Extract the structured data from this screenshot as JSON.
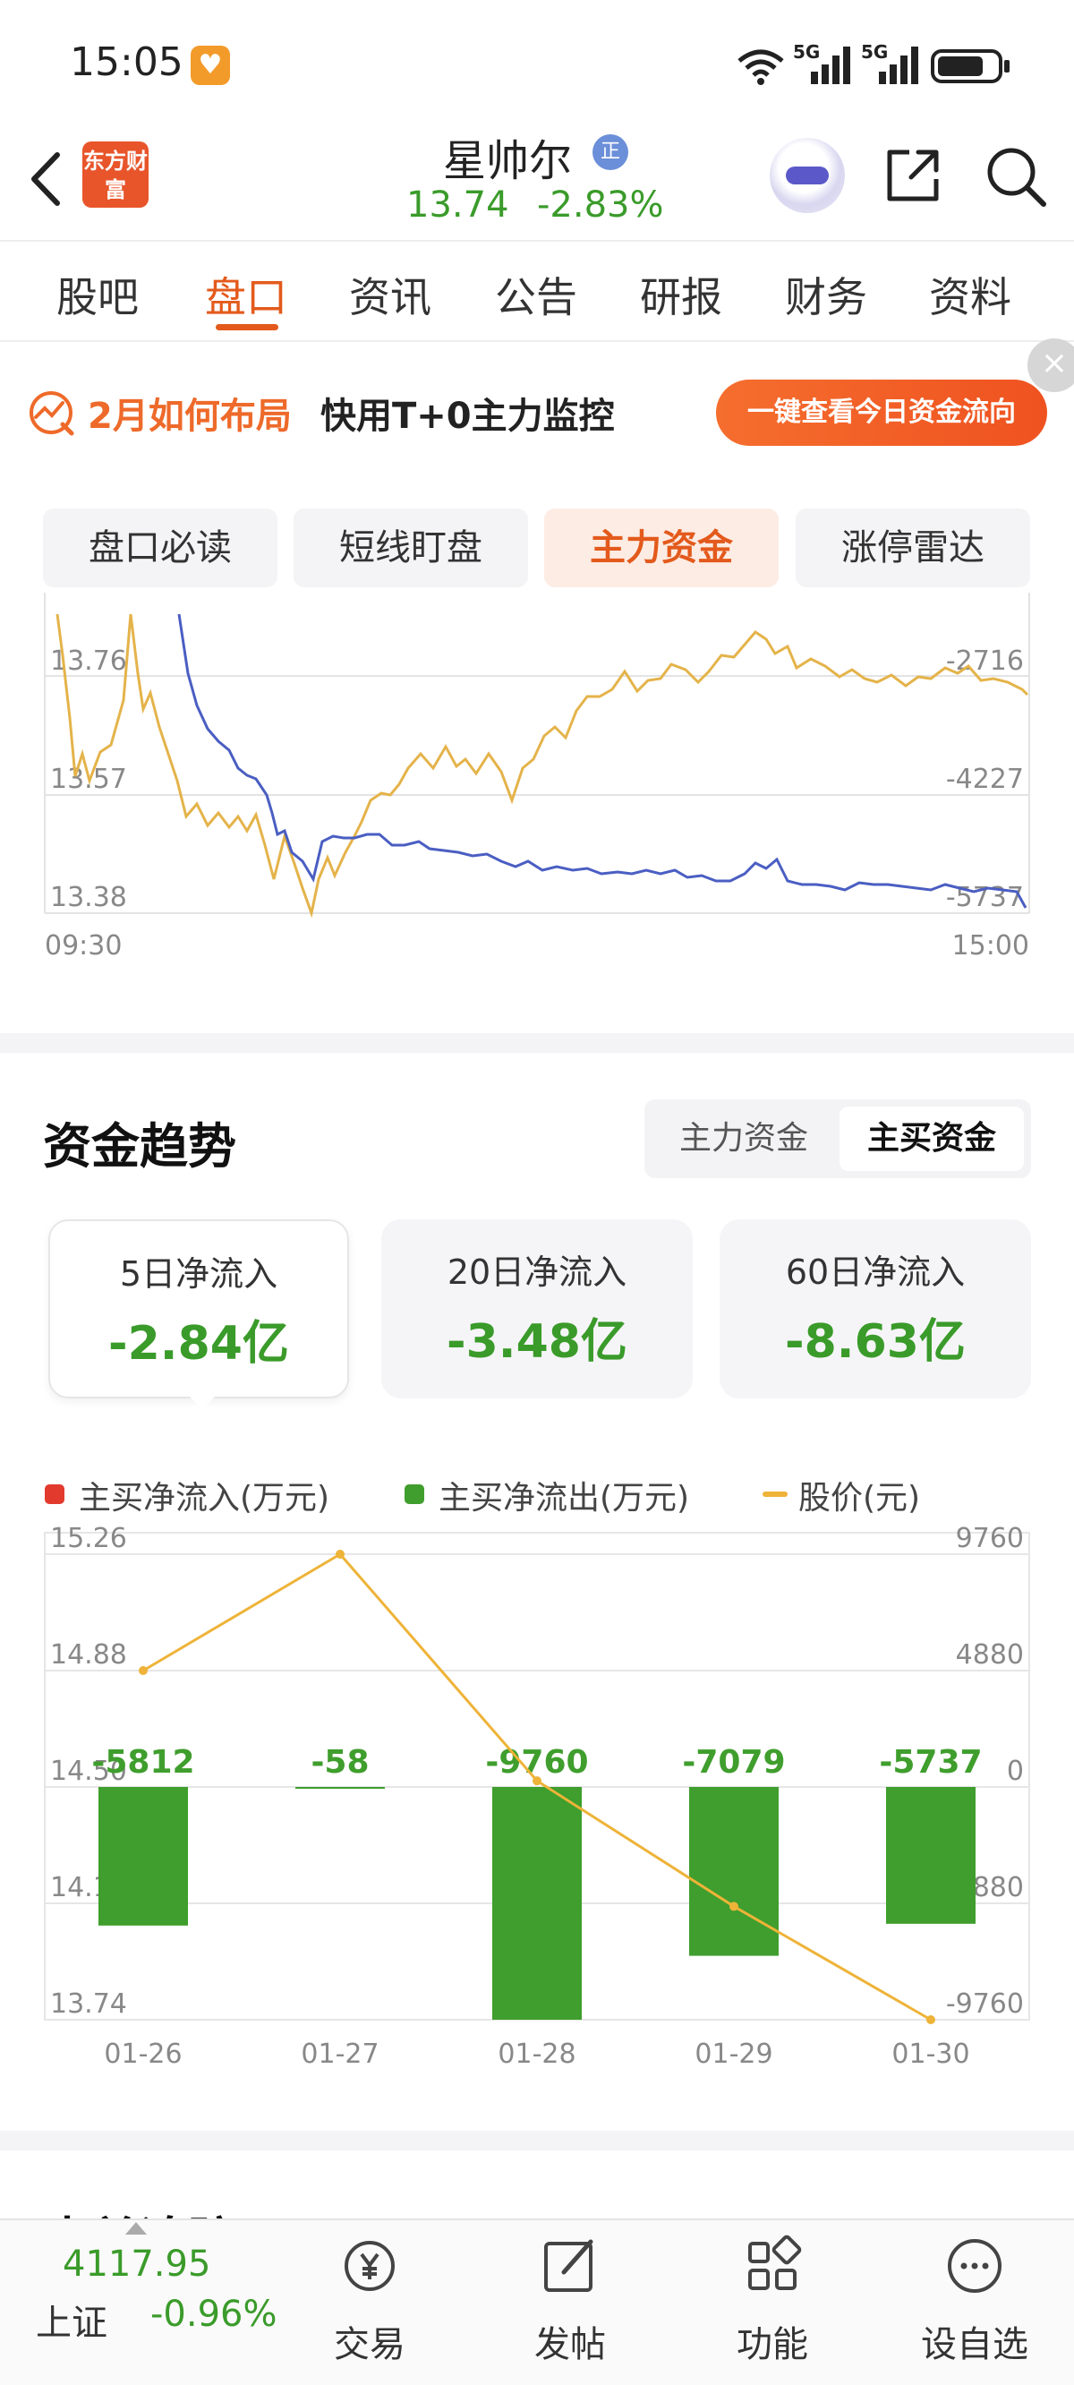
{
  "status_bar": {
    "time": "15:05",
    "network1": "5G",
    "network2": "5G"
  },
  "header": {
    "brand_logo": "东方财富",
    "stock_name": "星帅尔",
    "stock_badge": "正",
    "price": "13.74",
    "change_pct": "-2.83%"
  },
  "tabs": [
    "股吧",
    "盘口",
    "资讯",
    "公告",
    "研报",
    "财务",
    "资料"
  ],
  "active_tab": "盘口",
  "banner": {
    "title": "2月如何布局",
    "subtitle": "快用T+0主力监控",
    "button": "一键查看今日资金流向"
  },
  "subtabs": [
    "盘口必读",
    "短线盯盘",
    "主力资金",
    "涨停雷达"
  ],
  "active_subtab": "主力资金",
  "intraday_chart": {
    "left_ticks": [
      "13.76",
      "13.57",
      "13.38"
    ],
    "right_ticks": [
      "-2716",
      "-4227",
      "-5737"
    ],
    "time_start": "09:30",
    "time_end": "15:00"
  },
  "trend": {
    "title": "资金趋势",
    "segments": [
      "主力资金",
      "主买资金"
    ],
    "active_segment": "主买资金",
    "cards": [
      {
        "label": "5日净流入",
        "value": "-2.84亿"
      },
      {
        "label": "20日净流入",
        "value": "-3.48亿"
      },
      {
        "label": "60日净流入",
        "value": "-8.63亿"
      }
    ],
    "legend": {
      "inflow": "主买净流入(万元)",
      "outflow": "主买净流出(万元)",
      "price": "股价(元)"
    },
    "colors": {
      "inflow": "#e23b2e",
      "outflow": "#3f9e2d",
      "price": "#eeb338"
    }
  },
  "chart_data": {
    "type": "bar",
    "categories": [
      "01-26",
      "01-27",
      "01-28",
      "01-29",
      "01-30"
    ],
    "series": [
      {
        "name": "主买净流出(万元)",
        "values": [
          -5812,
          -58,
          -9760,
          -7079,
          -5737
        ]
      },
      {
        "name": "股价(元)",
        "values": [
          14.88,
          15.26,
          14.52,
          14.11,
          13.74
        ]
      }
    ],
    "left_axis_ticks": [
      "15.26",
      "14.88",
      "14.50",
      "14.12",
      "13.74"
    ],
    "right_axis_ticks": [
      "9760",
      "4880",
      "0",
      "-4880",
      "-9760"
    ],
    "ylim_left": [
      13.74,
      15.26
    ],
    "ylim_right": [
      -9760,
      9760
    ]
  },
  "next_section": {
    "title": "大单追踪"
  },
  "bottom_bar": {
    "index_value": "4117.95",
    "index_name": "上证",
    "index_change": "-0.96%",
    "nav": [
      "交易",
      "发帖",
      "功能",
      "设自选"
    ]
  }
}
